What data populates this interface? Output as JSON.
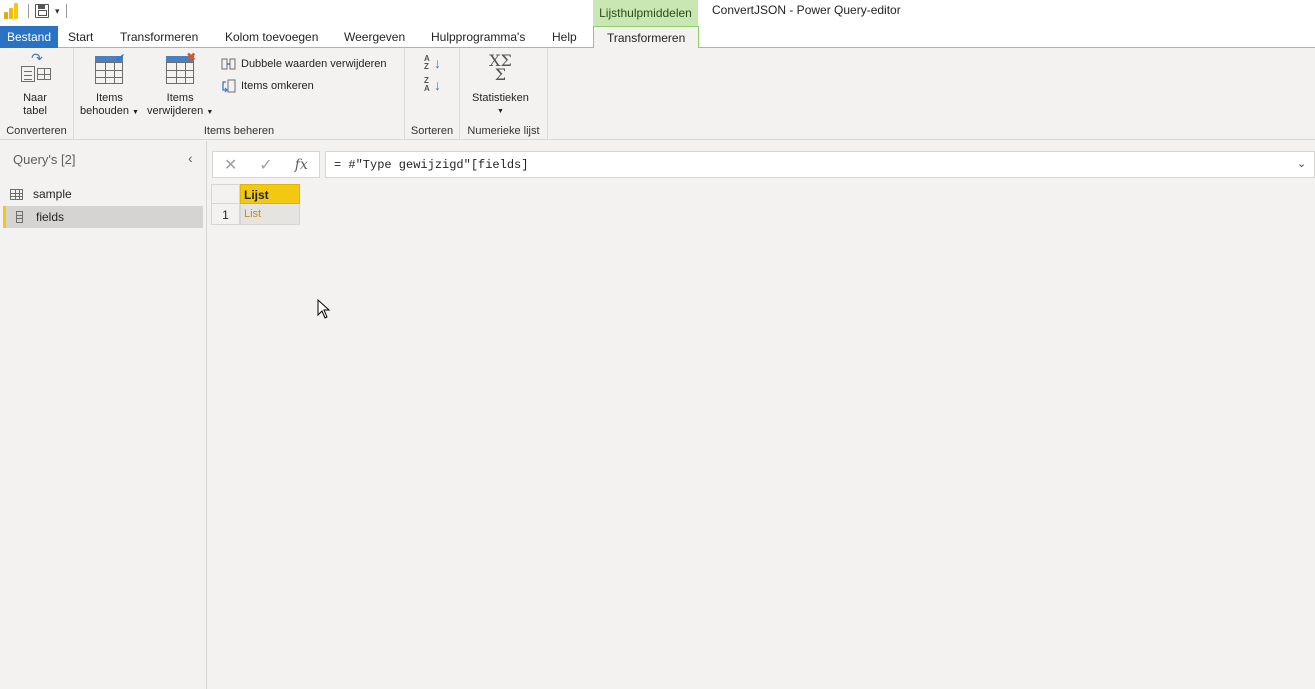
{
  "titlebar": {
    "context_group": "Lijsthulpmiddelen",
    "app_title": "ConvertJSON - Power Query-editor"
  },
  "tabs": {
    "file": "Bestand",
    "start": "Start",
    "transform": "Transformeren",
    "add_column": "Kolom toevoegen",
    "view": "Weergeven",
    "tools": "Hulpprogramma's",
    "help": "Help",
    "context_transform": "Transformeren"
  },
  "ribbon": {
    "convert_group": {
      "label": "Converteren",
      "to_table_line1": "Naar",
      "to_table_line2": "tabel"
    },
    "manage_group": {
      "label": "Items beheren",
      "keep_line1": "Items",
      "keep_line2": "behouden",
      "remove_line1": "Items",
      "remove_line2": "verwijderen",
      "remove_duplicates": "Dubbele waarden verwijderen",
      "reverse_items": "Items omkeren"
    },
    "sort_group": {
      "label": "Sorteren",
      "asc_letters": "A Z",
      "desc_letters": "Z A"
    },
    "numeric_group": {
      "label": "Numerieke lijst",
      "statistics": "Statistieken",
      "stats_symbol_top": "XΣ",
      "stats_symbol_bottom": "Σ"
    }
  },
  "queries": {
    "title": "Query's [2]",
    "items": [
      {
        "label": "sample",
        "type": "table",
        "selected": false
      },
      {
        "label": "fields",
        "type": "list",
        "selected": true
      }
    ]
  },
  "formula_bar": {
    "cancel": "✕",
    "commit": "✓",
    "fx": "fx",
    "formula": "= #\"Type gewijzigd\"[fields]"
  },
  "grid": {
    "column_header": "Lijst",
    "rows": [
      {
        "row_number": "1",
        "value": "List"
      }
    ]
  },
  "colors": {
    "file_tab": "#2a72c4",
    "context_group": "#c8e7b3",
    "column_header": "#f2c811",
    "list_link": "#c88a1f"
  }
}
